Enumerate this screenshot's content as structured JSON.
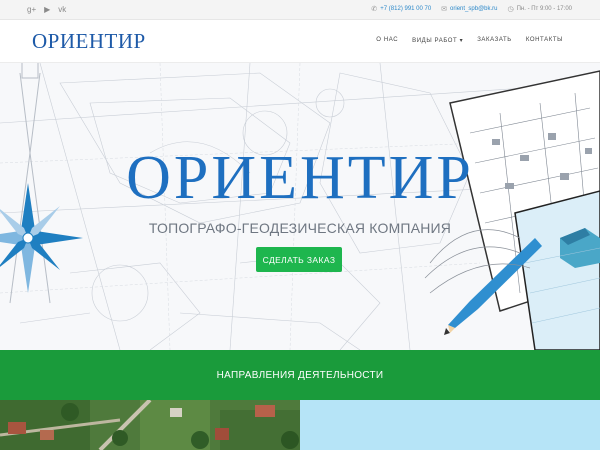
{
  "topbar": {
    "social": [
      {
        "icon": "google-plus-icon",
        "glyph": "g+"
      },
      {
        "icon": "youtube-icon",
        "glyph": "▶"
      },
      {
        "icon": "vk-icon",
        "glyph": "vk"
      }
    ],
    "phone": "+7 (812) 991 00 70",
    "email": "orient_spb@bk.ru",
    "hours": "Пн. - Пт 9:00 - 17:00"
  },
  "header": {
    "logo": "ОРИЕНТИР",
    "nav": [
      {
        "label": "О НАС"
      },
      {
        "label": "ВИДЫ РАБОТ ▾"
      },
      {
        "label": "ЗАКАЗАТЬ"
      },
      {
        "label": "КОНТАКТЫ"
      }
    ]
  },
  "hero": {
    "title": "ОРИЕНТИР",
    "subtitle": "ТОПОГРАФО-ГЕОДЕЗИЧЕСКАЯ КОМПАНИЯ",
    "button": "СДЕЛАТЬ ЗАКАЗ"
  },
  "section": {
    "title": "НАПРАВЛЕНИЯ ДЕЯТЕЛЬНОСТИ"
  },
  "colors": {
    "brand_blue": "#1e6fc0",
    "green_button": "#1eb64e",
    "green_band": "#1a9b3b",
    "link_blue": "#2c88c9"
  }
}
